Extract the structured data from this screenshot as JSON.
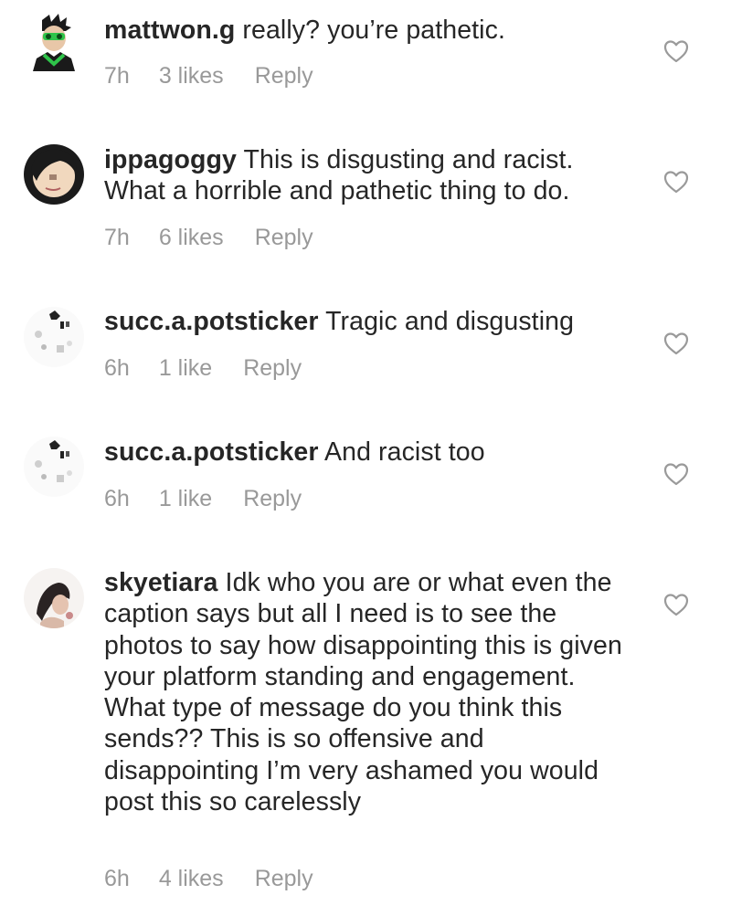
{
  "comments": [
    {
      "username": "mattwon.g",
      "text": "really? you’re pathetic.",
      "time": "7h",
      "likes": "3 likes",
      "reply": "Reply"
    },
    {
      "username": "ippagoggy",
      "text": "This is disgusting and racist. What a horrible and pathetic thing to do.",
      "time": "7h",
      "likes": "6 likes",
      "reply": "Reply"
    },
    {
      "username": "succ.a.potsticker",
      "text": "Tragic and disgusting",
      "time": "6h",
      "likes": "1 like",
      "reply": "Reply"
    },
    {
      "username": "succ.a.potsticker",
      "text": "And racist too",
      "time": "6h",
      "likes": "1 like",
      "reply": "Reply"
    },
    {
      "username": "skyetiara",
      "text": "Idk who you are or what even the caption says but all I need is to see the photos to say how disappointing this is given your platform standing and engagement. What type of message do you think this sends?? This is so offensive and disappointing I’m very ashamed you would post this so carelessly",
      "time": "6h",
      "likes": "4 likes",
      "reply": "Reply"
    }
  ],
  "icons": {
    "like": "heart-outline-icon"
  },
  "colors": {
    "text": "#262626",
    "meta": "#999999",
    "heart": "#9a9a9a"
  }
}
